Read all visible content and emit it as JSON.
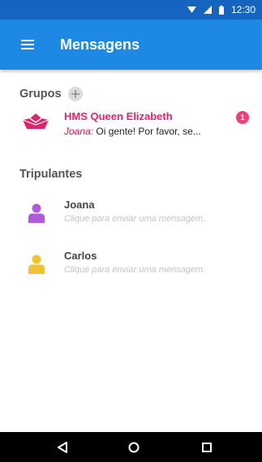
{
  "status_bar": {
    "time": "12:30",
    "icons": [
      "wifi-icon",
      "signal-icon",
      "battery-icon"
    ]
  },
  "app_bar": {
    "title": "Mensagens",
    "menu_icon": "hamburger-menu-icon"
  },
  "groups_section": {
    "title": "Grupos",
    "add_icon": "plus-icon",
    "items": [
      {
        "name": "HMS Queen Elizabeth",
        "sender": "Joana:",
        "preview": " Oi gente! Por favor, se...",
        "unread": "1",
        "icon": "paper-boat-icon"
      }
    ]
  },
  "crew_section": {
    "title": "Tripulantes",
    "members": [
      {
        "name": "Joana",
        "hint": "Clique para enviar uma mensagem.",
        "color": "#b05ad6"
      },
      {
        "name": "Carlos",
        "hint": "Clique para enviar uma mensagem.",
        "color": "#f1c232"
      }
    ]
  },
  "nav_bar": {
    "buttons": [
      "back-icon",
      "home-icon",
      "recents-icon"
    ]
  },
  "colors": {
    "status_bar": "#1565c0",
    "app_bar": "#1e88e5",
    "accent": "#e0246c",
    "badge": "#ec407a"
  }
}
